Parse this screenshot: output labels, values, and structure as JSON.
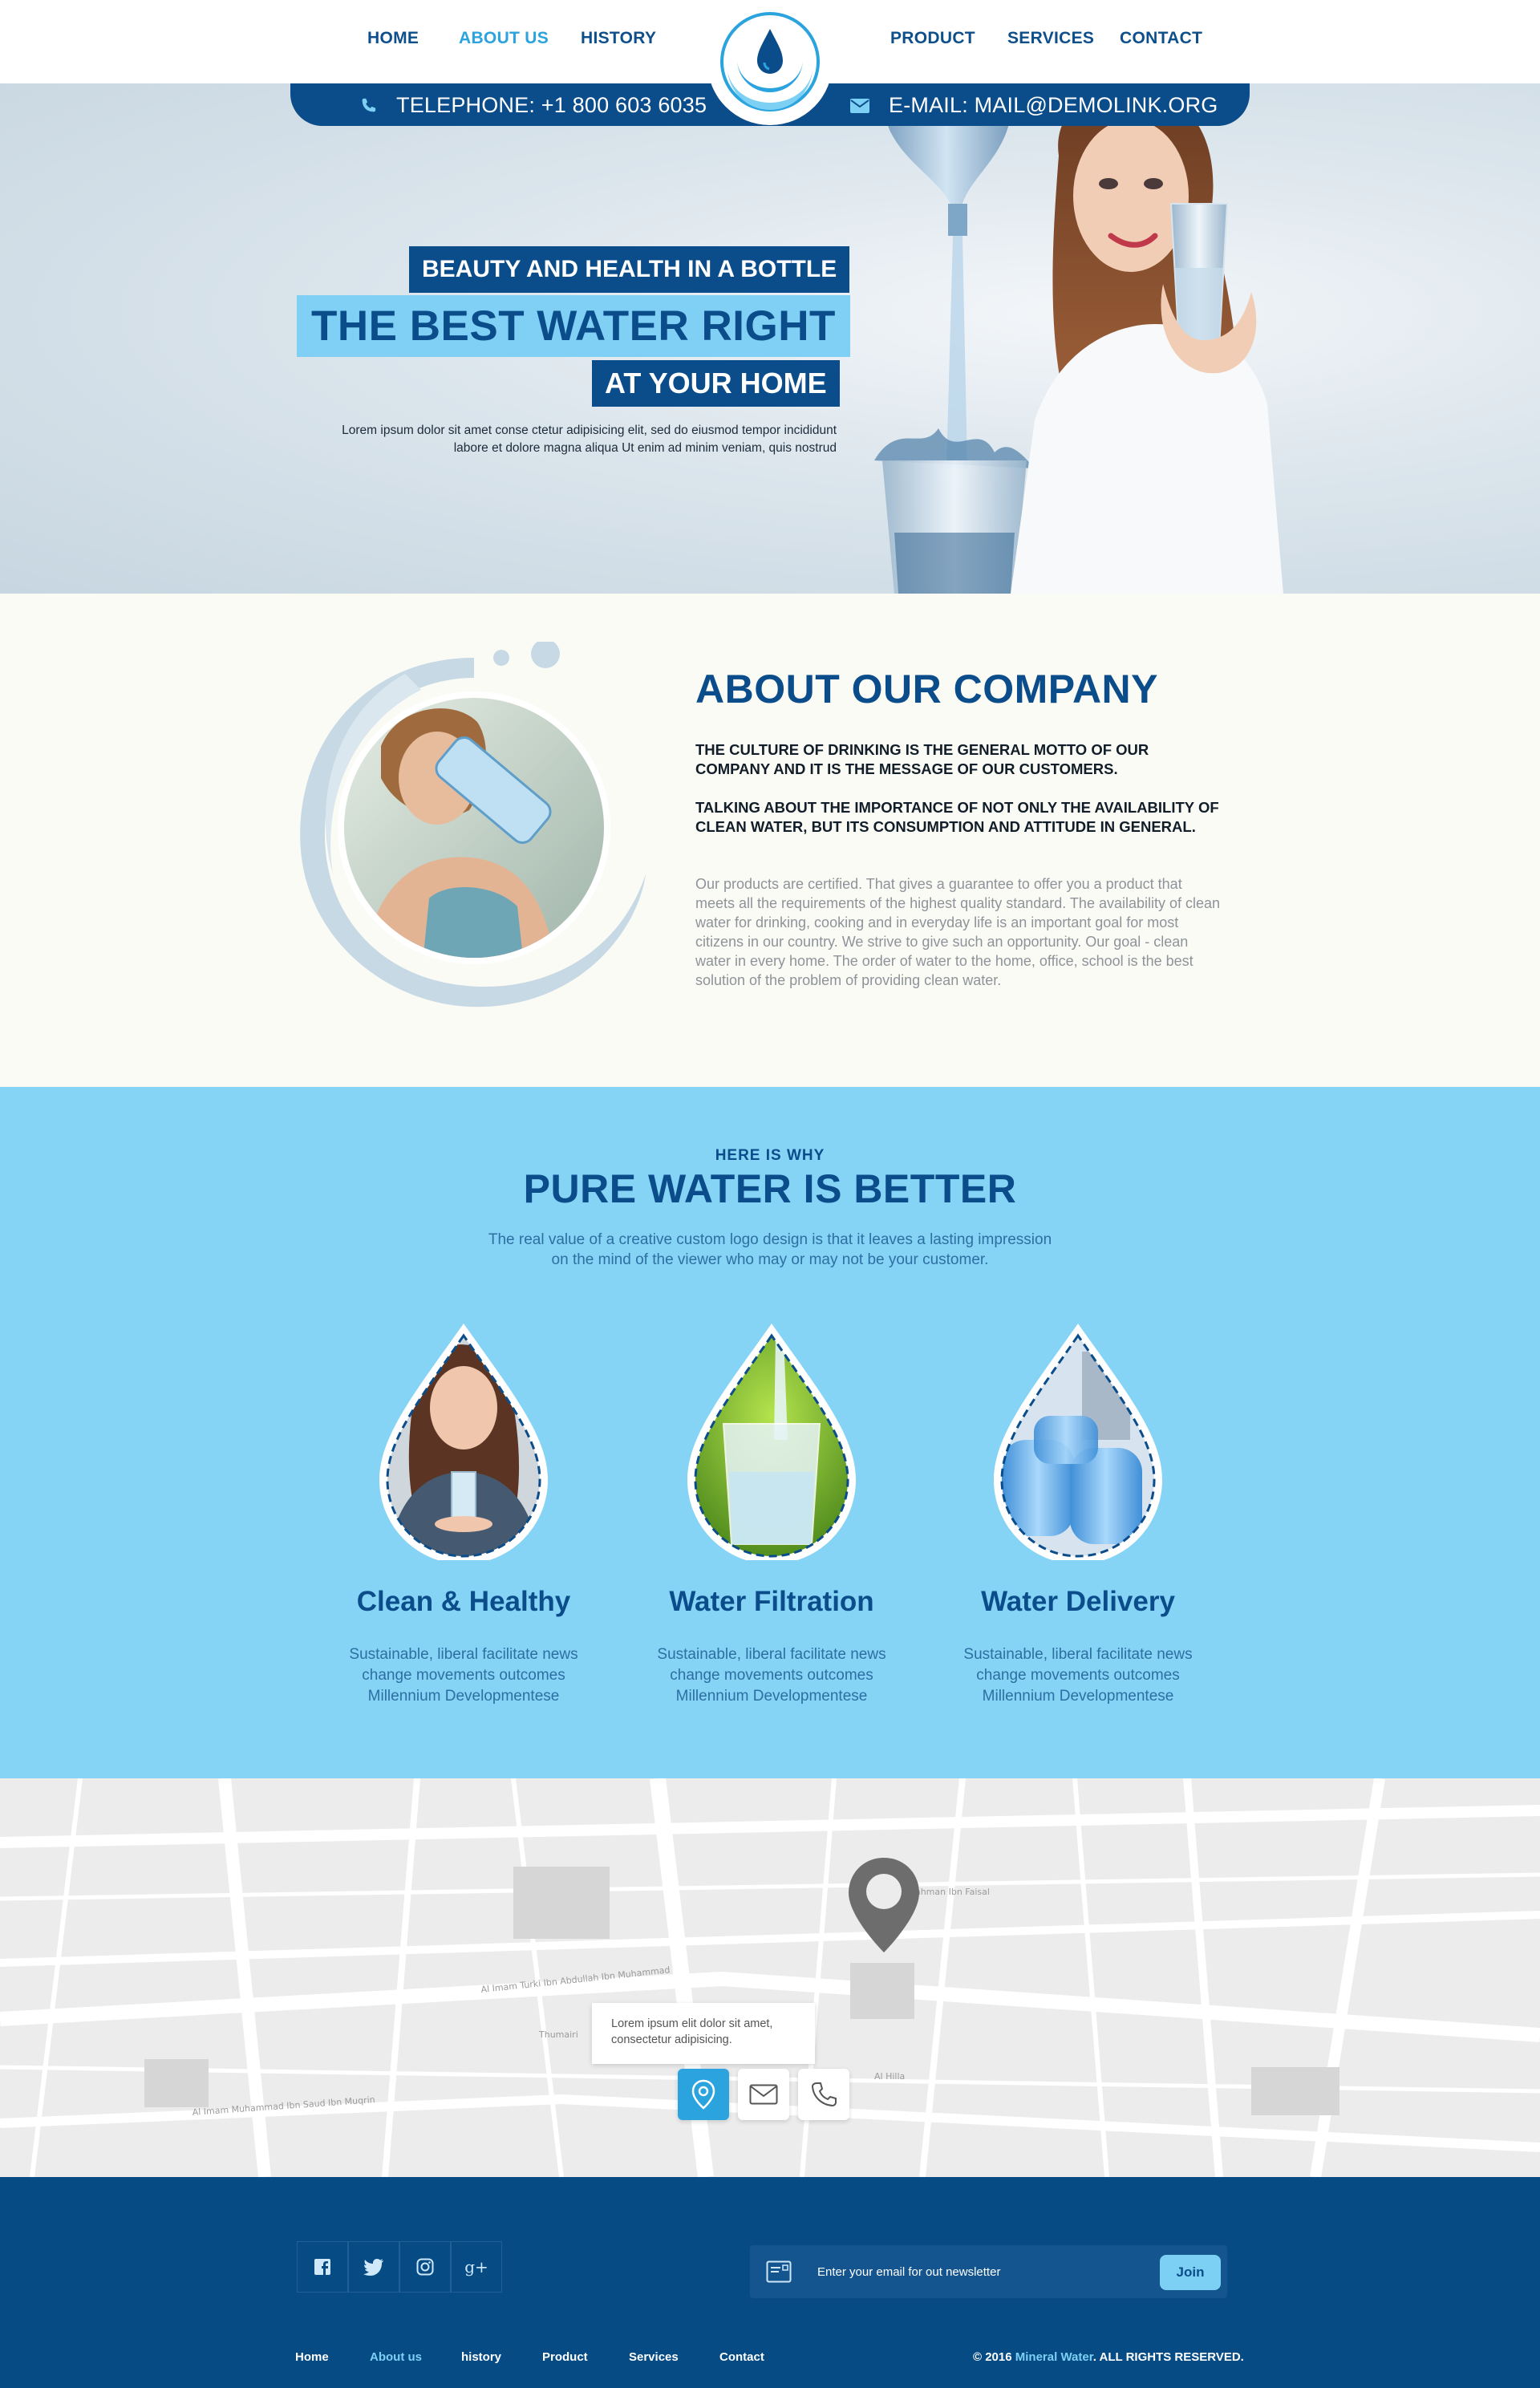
{
  "nav": {
    "left": [
      {
        "label": "HOME"
      },
      {
        "label": "ABOUT US",
        "active": true
      },
      {
        "label": "HISTORY"
      }
    ],
    "right": [
      {
        "label": "PRODUCT"
      },
      {
        "label": "SERVICES"
      },
      {
        "label": "CONTACT"
      }
    ]
  },
  "contact": {
    "telephone": "TELEPHONE: +1 800 603 6035",
    "email": "E-MAIL: MAIL@DEMOLINK.ORG"
  },
  "hero": {
    "tagline": "BEAUTY AND HEALTH IN A BOTTLE",
    "headline": "THE BEST WATER RIGHT",
    "headline_tail": "AT YOUR HOME",
    "text_line1": "Lorem ipsum dolor sit amet conse ctetur adipisicing elit, sed do eiusmod tempor incididunt",
    "text_line2": "labore et dolore magna aliqua Ut enim ad minim veniam, quis nostrud"
  },
  "about": {
    "title": "ABOUT OUR COMPANY",
    "lead1": "THE CULTURE OF DRINKING IS THE GENERAL MOTTO OF OUR COMPANY AND IT IS THE MESSAGE OF OUR CUSTOMERS.",
    "lead2": "TALKING ABOUT THE IMPORTANCE OF NOT ONLY THE AVAILABILITY OF CLEAN WATER, BUT ITS CONSUMPTION AND ATTITUDE IN GENERAL.",
    "body": "Our products are certified. That gives a guarantee to offer you a product that meets all the requirements of the highest quality standard. The availability of clean water for drinking, cooking and in everyday life is an important goal for most citizens in our country. We strive to give such an opportunity. Our goal - clean water in every home. The order of water to the home, office, school is the best solution of the problem of providing clean water."
  },
  "why": {
    "kicker": "HERE IS WHY",
    "title": "PURE WATER IS BETTER",
    "subtitle_line1": "The real value of a creative custom logo design is that it leaves a lasting impression",
    "subtitle_line2": "on the mind of the viewer who may or may not be your customer.",
    "features": [
      {
        "title": "Clean & Healthy",
        "line1": "Sustainable, liberal facilitate news",
        "line2": "change movements outcomes",
        "line3": "Millennium Developmentese"
      },
      {
        "title": "Water Filtration",
        "line1": "Sustainable, liberal facilitate news",
        "line2": "change movements outcomes",
        "line3": "Millennium Developmentese"
      },
      {
        "title": "Water Delivery",
        "line1": "Sustainable, liberal facilitate news",
        "line2": "change movements outcomes",
        "line3": "Millennium Developmentese"
      }
    ]
  },
  "map": {
    "bubble_line1": "Lorem ipsum elit dolor sit amet,",
    "bubble_line2": "consectetur adipisicing.",
    "buttons": [
      {
        "icon": "location-pin-icon"
      },
      {
        "icon": "envelope-icon"
      },
      {
        "icon": "phone-icon"
      }
    ],
    "street_labels": [
      "Al Imam Turki Ibn Abdullah Ibn Muhammad",
      "Al Imam Muhammad Ibn Saud Ibn Muqrin",
      "Imam Abdulrahman Ibn Faisal",
      "Al Hilla",
      "Thumairi"
    ]
  },
  "footer": {
    "social": [
      {
        "icon": "facebook-icon"
      },
      {
        "icon": "twitter-icon"
      },
      {
        "icon": "instagram-icon"
      },
      {
        "icon": "google-plus-icon",
        "glyph": "g+"
      }
    ],
    "newsletter_placeholder": "Enter your email for out newsletter",
    "join_label": "Join",
    "links": [
      {
        "label": "Home"
      },
      {
        "label": "About us",
        "active": true
      },
      {
        "label": "history"
      },
      {
        "label": "Product"
      },
      {
        "label": "Services"
      },
      {
        "label": "Contact"
      }
    ],
    "copyright_prefix": "© 2016 ",
    "copyright_brand": "Mineral Water",
    "copyright_suffix": ". ALL RIGHTS RESERVED."
  },
  "colors": {
    "primary": "#0b4d8a",
    "accent": "#2aa3de",
    "light_blue": "#85d3f5",
    "footer": "#074b85"
  }
}
